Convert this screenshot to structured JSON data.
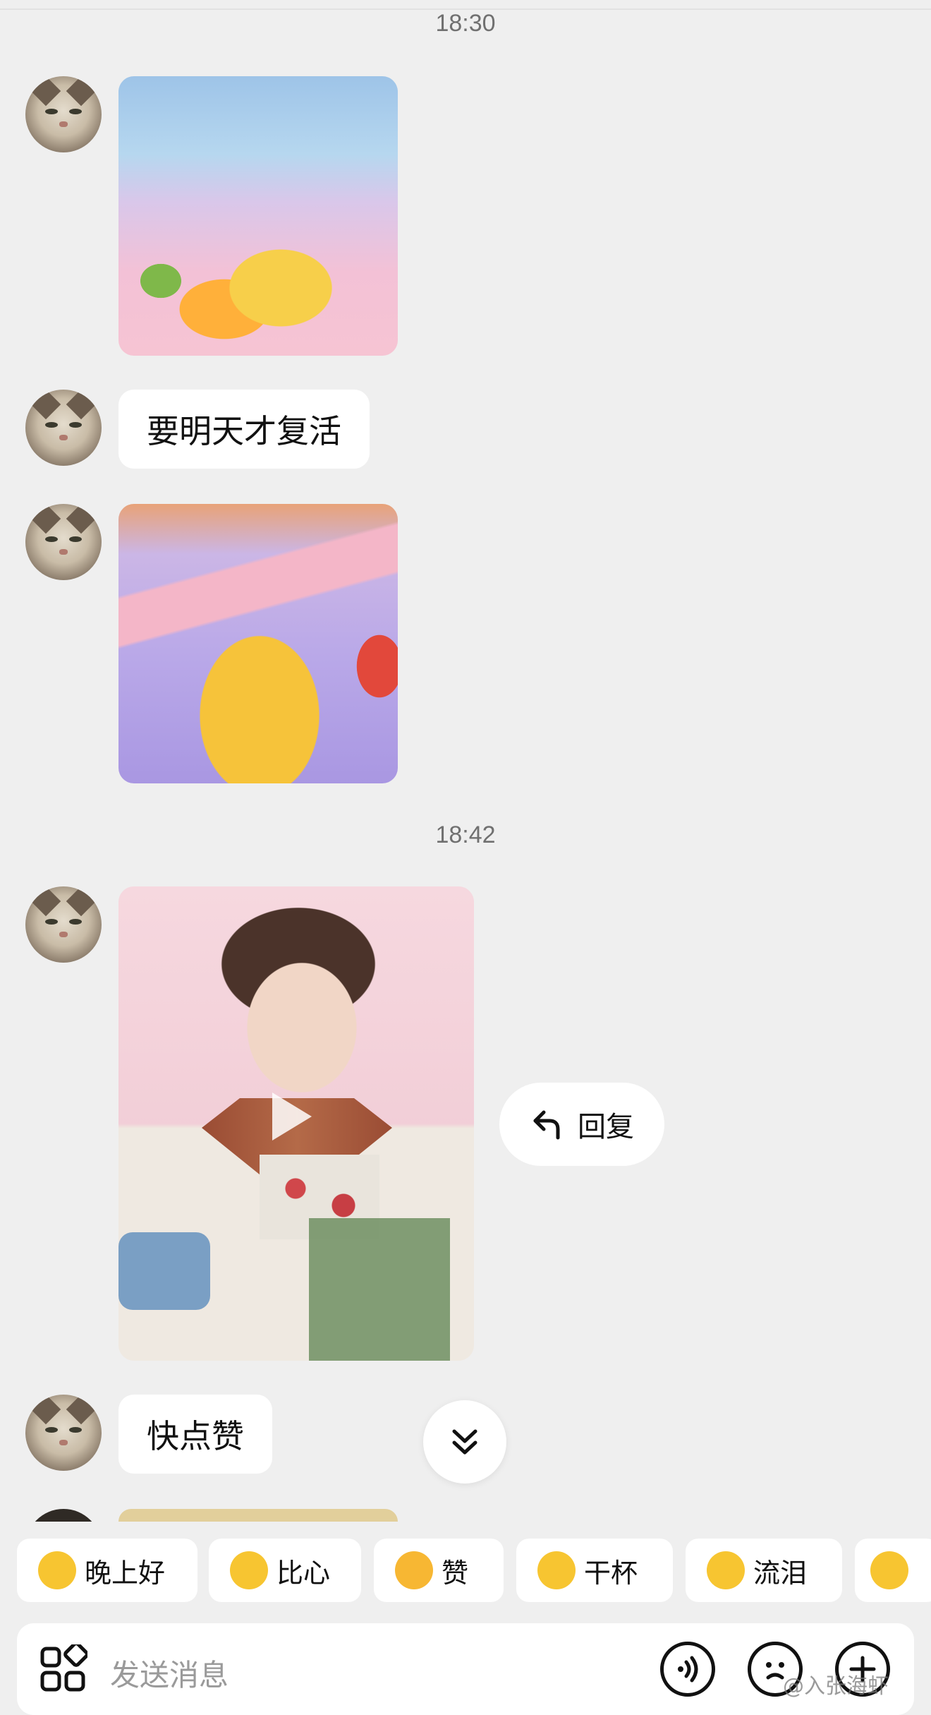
{
  "chat": {
    "timestamps": [
      "18:30",
      "18:42"
    ],
    "messages": [
      {
        "type": "image",
        "description_icon": "sticker-image"
      },
      {
        "type": "text",
        "text": "要明天才复活"
      },
      {
        "type": "image",
        "description_icon": "sticker-image"
      },
      {
        "type": "video",
        "description_icon": "play-icon"
      },
      {
        "type": "text",
        "text": "快点赞"
      }
    ],
    "context_action": {
      "label": "回复",
      "icon": "reply-arrow-icon"
    }
  },
  "quick_replies": [
    {
      "label": "晚上好",
      "icon": "star-face-emoji",
      "color": "#f7c531"
    },
    {
      "label": "比心",
      "icon": "heart-hands-emoji",
      "color": "#f7c531"
    },
    {
      "label": "赞",
      "icon": "thumbs-up-emoji",
      "color": "#f7b733"
    },
    {
      "label": "干杯",
      "icon": "cheers-emoji",
      "color": "#f7c531"
    },
    {
      "label": "流泪",
      "icon": "crying-emoji",
      "color": "#f7c531"
    }
  ],
  "input": {
    "placeholder": "发送消息",
    "icons": [
      "apps-grid-icon",
      "voice-icon",
      "emoji-icon",
      "plus-icon"
    ]
  },
  "watermark": "@入张海虾"
}
